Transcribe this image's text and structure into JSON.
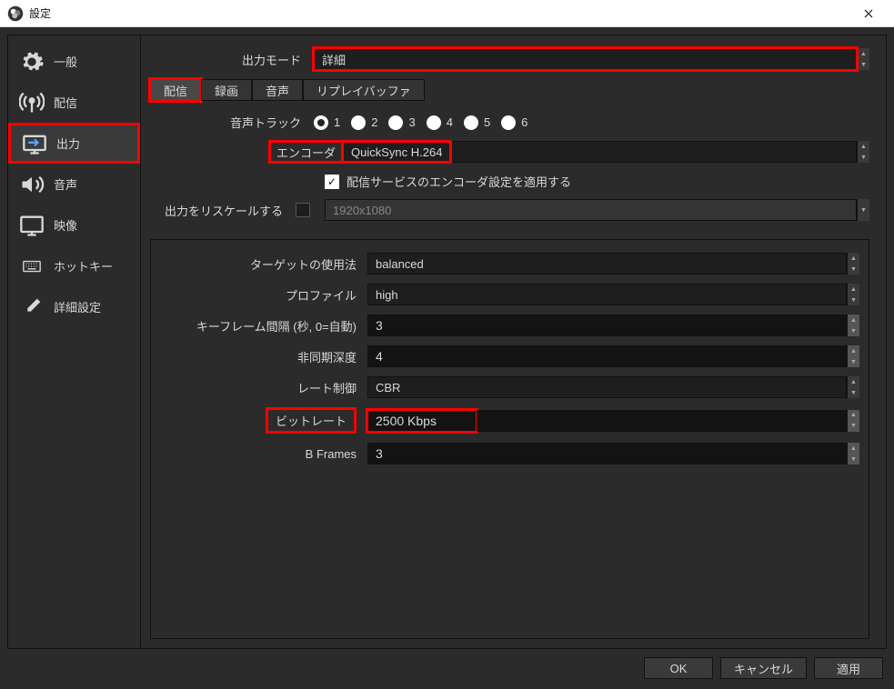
{
  "window": {
    "title": "設定"
  },
  "sidebar": {
    "items": [
      {
        "label": "一般"
      },
      {
        "label": "配信"
      },
      {
        "label": "出力"
      },
      {
        "label": "音声"
      },
      {
        "label": "映像"
      },
      {
        "label": "ホットキー"
      },
      {
        "label": "詳細設定"
      }
    ]
  },
  "output_mode": {
    "label": "出力モード",
    "value": "詳細"
  },
  "tabs": [
    "配信",
    "録画",
    "音声",
    "リプレイバッファ"
  ],
  "audio_track": {
    "label": "音声トラック",
    "options": [
      "1",
      "2",
      "3",
      "4",
      "5",
      "6"
    ],
    "selected": "1"
  },
  "encoder": {
    "label": "エンコーダ",
    "value": "QuickSync H.264"
  },
  "enforce": {
    "label": "配信サービスのエンコーダ設定を適用する",
    "checked": true
  },
  "rescale": {
    "label": "出力をリスケールする",
    "checked": false,
    "value": "1920x1080"
  },
  "encoder_settings": {
    "target_usage": {
      "label": "ターゲットの使用法",
      "value": "balanced"
    },
    "profile": {
      "label": "プロファイル",
      "value": "high"
    },
    "keyframe": {
      "label": "キーフレーム間隔 (秒, 0=自動)",
      "value": "3"
    },
    "async_depth": {
      "label": "非同期深度",
      "value": "4"
    },
    "rate_control": {
      "label": "レート制御",
      "value": "CBR"
    },
    "bitrate": {
      "label": "ビットレート",
      "value": "2500 Kbps"
    },
    "bframes": {
      "label": "B Frames",
      "value": "3"
    }
  },
  "footer": {
    "ok": "OK",
    "cancel": "キャンセル",
    "apply": "適用"
  }
}
